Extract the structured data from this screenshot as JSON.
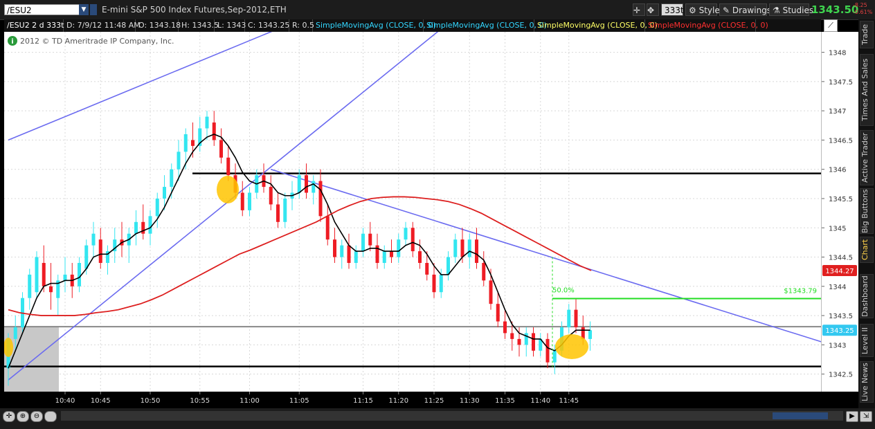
{
  "header": {
    "symbol": "/ESU2",
    "description": "E-mini S&P 500 Index Futures,Sep-2012,ETH",
    "aggregation": "333t",
    "style_label": "Style",
    "drawings_label": "Drawings",
    "studies_label": "Studies",
    "last_price": "1343.50",
    "change_abs": "-8.25",
    "change_pct": "-0.61%"
  },
  "infobar": {
    "symbol": "/ESU2 2 d 333t",
    "date": "D: 7/9/12 11:48 AM",
    "open": "O: 1343.18",
    "high": "H: 1343.5",
    "low": "L: 1343",
    "close": "C: 1343.25",
    "range": "R: 0.5",
    "studies": [
      {
        "label": "SimpleMovingAvg (CLOSE, 0, 0)",
        "color": "#33d6ff"
      },
      {
        "label": "SimpleMovingAvg (CLOSE, 0, 0)",
        "color": "#33d6ff"
      },
      {
        "label": "SimpleMovingAvg (CLOSE, 0, 0)",
        "color": "#ffff66"
      },
      {
        "label": "SimpleMovingAvg (CLOSE, 0, 0)",
        "color": "#ff3030"
      }
    ]
  },
  "copyright": "2012 © TD Ameritrade IP Company, Inc.",
  "sidebar_tabs": [
    "Trade",
    "Times And Sales",
    "Active Trader",
    "Big Buttons",
    "Chart",
    "Dashboard",
    "Level II",
    "Live News"
  ],
  "colors": {
    "up_bar": "#33e6f0",
    "down_bar": "#ee1c24",
    "sma_fast": "#000000",
    "sma_slow": "#dd1f1f",
    "trendline": "#6b6bf0",
    "fib_line": "#22dd22",
    "highlight": "#ffc400"
  },
  "chart_data": {
    "type": "candlestick",
    "x_tick_labels": [
      "10:40",
      "10:45",
      "10:50",
      "10:55",
      "11:00",
      "11:05",
      "11:15",
      "11:20",
      "11:25",
      "11:30",
      "11:35",
      "11:40",
      "11:45"
    ],
    "y_tick_labels": [
      "1342.5",
      "1343",
      "1343.5",
      "1344",
      "1344.5",
      "1345",
      "1345.5",
      "1346",
      "1346.5",
      "1347",
      "1347.5",
      "1348"
    ],
    "ylim": [
      1342.2,
      1348.35
    ],
    "grid": true,
    "price_labels": [
      {
        "value": 1344.27,
        "text": "1344.27",
        "color": "#e02020"
      },
      {
        "value": 1343.25,
        "text": "1343.25",
        "color": "#33c8f0"
      }
    ],
    "horizontal_levels": [
      1345.93,
      1343.31,
      1342.63
    ],
    "fib": {
      "value": 1343.79,
      "label": "$1343.79",
      "pct_label": "50.0%"
    },
    "bars": [
      [
        1342.6,
        1343.2,
        1342.3,
        1343.1
      ],
      [
        1343.1,
        1343.5,
        1342.9,
        1343.3
      ],
      [
        1343.3,
        1343.9,
        1343.2,
        1343.8
      ],
      [
        1343.8,
        1344.3,
        1343.6,
        1344.2
      ],
      [
        1343.9,
        1344.6,
        1343.8,
        1344.5
      ],
      [
        1344.4,
        1344.7,
        1343.9,
        1344.0
      ],
      [
        1344.0,
        1344.4,
        1343.6,
        1343.9
      ],
      [
        1343.8,
        1344.2,
        1343.5,
        1344.1
      ],
      [
        1344.1,
        1344.5,
        1343.9,
        1344.2
      ],
      [
        1344.2,
        1344.4,
        1343.8,
        1344.0
      ],
      [
        1344.0,
        1344.5,
        1343.9,
        1344.4
      ],
      [
        1344.3,
        1344.8,
        1344.2,
        1344.7
      ],
      [
        1344.7,
        1345.1,
        1344.5,
        1344.9
      ],
      [
        1344.8,
        1345.0,
        1344.3,
        1344.4
      ],
      [
        1344.4,
        1344.7,
        1344.2,
        1344.6
      ],
      [
        1344.6,
        1345.0,
        1344.4,
        1344.8
      ],
      [
        1344.8,
        1345.1,
        1344.5,
        1344.7
      ],
      [
        1344.7,
        1345.0,
        1344.4,
        1344.9
      ],
      [
        1344.9,
        1345.3,
        1344.7,
        1345.1
      ],
      [
        1345.1,
        1345.4,
        1344.8,
        1344.9
      ],
      [
        1344.9,
        1345.3,
        1344.7,
        1345.2
      ],
      [
        1345.2,
        1345.6,
        1345.0,
        1345.5
      ],
      [
        1345.5,
        1345.9,
        1345.3,
        1345.7
      ],
      [
        1345.7,
        1346.1,
        1345.5,
        1346.0
      ],
      [
        1346.0,
        1346.5,
        1345.8,
        1346.3
      ],
      [
        1346.3,
        1346.7,
        1346.0,
        1346.6
      ],
      [
        1346.5,
        1346.8,
        1346.2,
        1346.4
      ],
      [
        1346.4,
        1346.9,
        1346.3,
        1346.7
      ],
      [
        1346.7,
        1347.0,
        1346.5,
        1346.9
      ],
      [
        1346.8,
        1347.0,
        1346.4,
        1346.5
      ],
      [
        1346.5,
        1346.7,
        1346.1,
        1346.2
      ],
      [
        1346.2,
        1346.4,
        1345.8,
        1345.9
      ],
      [
        1345.9,
        1346.1,
        1345.5,
        1345.6
      ],
      [
        1345.6,
        1345.8,
        1345.2,
        1345.3
      ],
      [
        1345.3,
        1345.7,
        1345.2,
        1345.6
      ],
      [
        1345.6,
        1346.0,
        1345.5,
        1345.9
      ],
      [
        1345.9,
        1346.1,
        1345.6,
        1345.7
      ],
      [
        1345.7,
        1345.9,
        1345.3,
        1345.4
      ],
      [
        1345.4,
        1345.6,
        1345.0,
        1345.1
      ],
      [
        1345.1,
        1345.6,
        1345.0,
        1345.5
      ],
      [
        1345.5,
        1345.8,
        1345.3,
        1345.6
      ],
      [
        1345.6,
        1346.0,
        1345.5,
        1345.9
      ],
      [
        1345.9,
        1346.1,
        1345.5,
        1345.6
      ],
      [
        1345.6,
        1345.9,
        1345.4,
        1345.8
      ],
      [
        1345.8,
        1346.0,
        1345.1,
        1345.2
      ],
      [
        1345.2,
        1345.4,
        1344.7,
        1344.8
      ],
      [
        1344.8,
        1345.0,
        1344.4,
        1344.5
      ],
      [
        1344.5,
        1344.8,
        1344.3,
        1344.7
      ],
      [
        1344.7,
        1344.9,
        1344.3,
        1344.4
      ],
      [
        1344.4,
        1344.7,
        1344.3,
        1344.6
      ],
      [
        1344.6,
        1345.0,
        1344.5,
        1344.9
      ],
      [
        1344.9,
        1345.1,
        1344.6,
        1344.7
      ],
      [
        1344.7,
        1344.9,
        1344.3,
        1344.4
      ],
      [
        1344.4,
        1344.7,
        1344.3,
        1344.6
      ],
      [
        1344.6,
        1344.8,
        1344.4,
        1344.5
      ],
      [
        1344.5,
        1344.9,
        1344.4,
        1344.8
      ],
      [
        1344.8,
        1345.1,
        1344.7,
        1345.0
      ],
      [
        1345.0,
        1345.1,
        1344.5,
        1344.6
      ],
      [
        1344.6,
        1344.8,
        1344.3,
        1344.4
      ],
      [
        1344.4,
        1344.6,
        1344.1,
        1344.2
      ],
      [
        1344.2,
        1344.4,
        1343.8,
        1343.9
      ],
      [
        1343.9,
        1344.3,
        1343.8,
        1344.2
      ],
      [
        1344.2,
        1344.6,
        1344.1,
        1344.5
      ],
      [
        1344.5,
        1344.9,
        1344.4,
        1344.8
      ],
      [
        1344.8,
        1345.0,
        1344.4,
        1344.5
      ],
      [
        1344.5,
        1344.9,
        1344.3,
        1344.8
      ],
      [
        1344.8,
        1345.0,
        1344.3,
        1344.4
      ],
      [
        1344.4,
        1344.6,
        1344.0,
        1344.1
      ],
      [
        1344.1,
        1344.3,
        1343.6,
        1343.7
      ],
      [
        1343.7,
        1343.9,
        1343.3,
        1343.4
      ],
      [
        1343.4,
        1343.6,
        1343.1,
        1343.2
      ],
      [
        1343.2,
        1343.4,
        1342.9,
        1343.1
      ],
      [
        1343.1,
        1343.3,
        1342.8,
        1343.0
      ],
      [
        1343.0,
        1343.3,
        1342.8,
        1343.2
      ],
      [
        1343.2,
        1343.3,
        1342.8,
        1342.9
      ],
      [
        1342.9,
        1343.2,
        1342.8,
        1343.1
      ],
      [
        1343.1,
        1343.2,
        1342.6,
        1342.7
      ],
      [
        1342.7,
        1343.0,
        1342.5,
        1342.9
      ],
      [
        1342.9,
        1343.4,
        1342.8,
        1343.3
      ],
      [
        1343.3,
        1343.7,
        1343.2,
        1343.6
      ],
      [
        1343.6,
        1343.8,
        1343.2,
        1343.3
      ],
      [
        1343.3,
        1343.5,
        1343.0,
        1343.1
      ],
      [
        1343.1,
        1343.4,
        1342.9,
        1343.25
      ]
    ],
    "sma_fast": [
      1342.6,
      1342.9,
      1343.2,
      1343.5,
      1343.8,
      1344.0,
      1344.05,
      1344.05,
      1344.1,
      1344.1,
      1344.15,
      1344.3,
      1344.5,
      1344.55,
      1344.55,
      1344.65,
      1344.75,
      1344.8,
      1344.9,
      1344.95,
      1345.0,
      1345.15,
      1345.35,
      1345.6,
      1345.85,
      1346.1,
      1346.3,
      1346.45,
      1346.55,
      1346.6,
      1346.55,
      1346.4,
      1346.2,
      1345.95,
      1345.8,
      1345.75,
      1345.8,
      1345.75,
      1345.6,
      1345.55,
      1345.55,
      1345.6,
      1345.7,
      1345.75,
      1345.65,
      1345.4,
      1345.1,
      1344.9,
      1344.7,
      1344.6,
      1344.6,
      1344.65,
      1344.65,
      1344.6,
      1344.6,
      1344.6,
      1344.7,
      1344.75,
      1344.7,
      1344.55,
      1344.35,
      1344.2,
      1344.2,
      1344.35,
      1344.5,
      1344.6,
      1344.55,
      1344.45,
      1344.2,
      1343.9,
      1343.6,
      1343.35,
      1343.2,
      1343.15,
      1343.1,
      1343.1,
      1342.95,
      1342.9,
      1343.0,
      1343.15,
      1343.25,
      1343.25,
      1343.25
    ],
    "sma_slow": [
      1343.6,
      1343.55,
      1343.52,
      1343.5,
      1343.5,
      1343.5,
      1343.5,
      1343.52,
      1343.55,
      1343.57,
      1343.6,
      1343.65,
      1343.7,
      1343.77,
      1343.85,
      1343.95,
      1344.05,
      1344.15,
      1344.25,
      1344.35,
      1344.45,
      1344.55,
      1344.62,
      1344.7,
      1344.78,
      1344.86,
      1344.94,
      1345.02,
      1345.1,
      1345.2,
      1345.3,
      1345.38,
      1345.45,
      1345.5,
      1345.52,
      1345.53,
      1345.53,
      1345.52,
      1345.5,
      1345.48,
      1345.45,
      1345.4,
      1345.33,
      1345.25,
      1345.15,
      1345.05,
      1344.95,
      1344.85,
      1344.75,
      1344.65,
      1344.55,
      1344.45,
      1344.35,
      1344.27
    ],
    "trendlines": [
      {
        "from": [
          0,
          1346.5
        ],
        "to": [
          38,
          1348.4
        ]
      },
      {
        "from": [
          0,
          1342.4
        ],
        "to": [
          61,
          1348.4
        ]
      },
      {
        "from": [
          37,
          1346.0
        ],
        "to": [
          137,
          1342.2
        ]
      }
    ]
  }
}
